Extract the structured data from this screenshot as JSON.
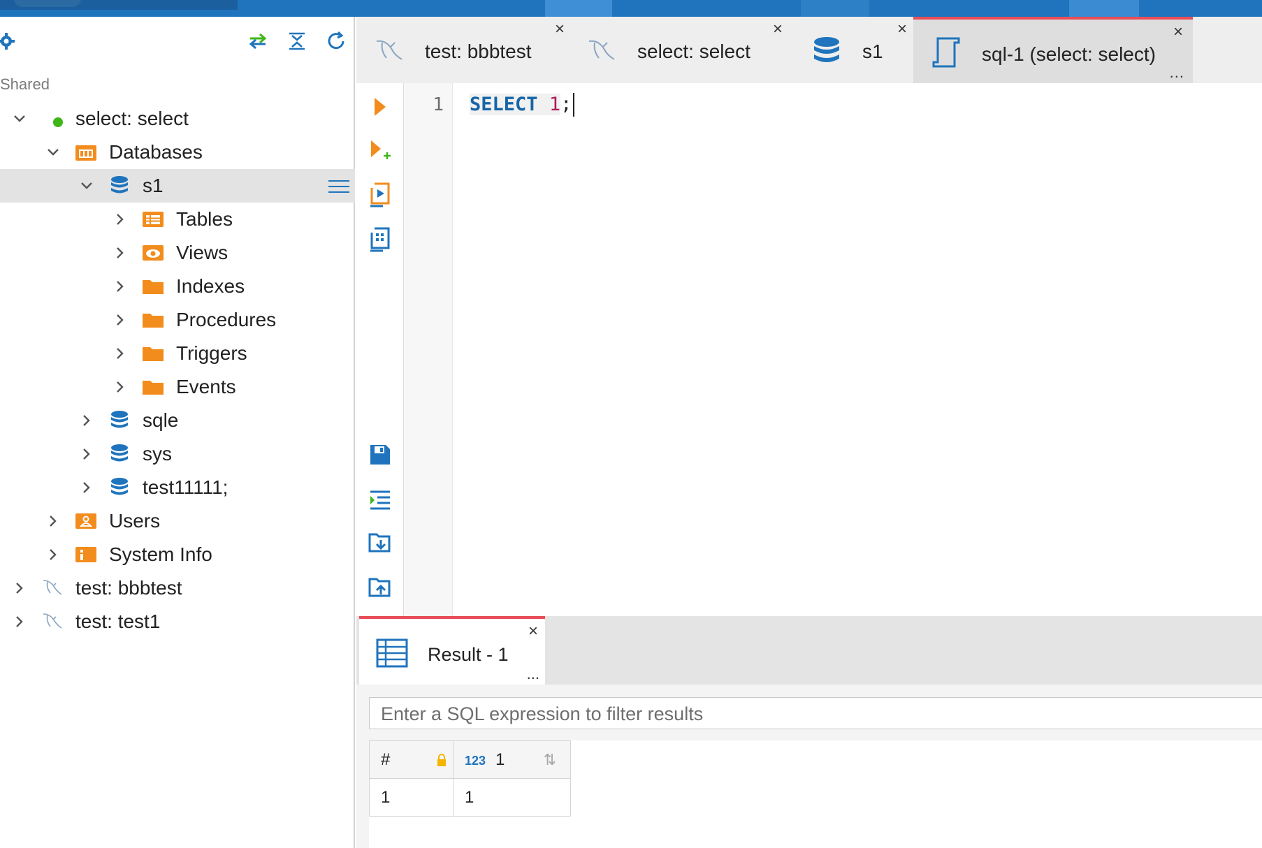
{
  "navigator": {
    "section_label": "Shared",
    "tree": [
      {
        "label": "select: select",
        "icon": "connected-dot-icon"
      },
      {
        "label": "Databases",
        "icon": "databases-folder-icon"
      },
      {
        "label": "s1",
        "icon": "database-icon"
      },
      {
        "label": "Tables",
        "icon": "tables-folder-icon"
      },
      {
        "label": "Views",
        "icon": "views-folder-icon"
      },
      {
        "label": "Indexes",
        "icon": "folder-icon"
      },
      {
        "label": "Procedures",
        "icon": "folder-icon"
      },
      {
        "label": "Triggers",
        "icon": "folder-icon"
      },
      {
        "label": "Events",
        "icon": "folder-icon"
      },
      {
        "label": "sqle",
        "icon": "database-icon"
      },
      {
        "label": "sys",
        "icon": "database-icon"
      },
      {
        "label": "test11111;",
        "icon": "database-icon"
      },
      {
        "label": "Users",
        "icon": "users-folder-icon"
      },
      {
        "label": "System Info",
        "icon": "system-info-folder-icon"
      },
      {
        "label": "test: bbbtest",
        "icon": "mysql-dolphin-icon"
      },
      {
        "label": "test: test1",
        "icon": "mysql-dolphin-icon"
      }
    ]
  },
  "tabs": [
    {
      "label": "test: bbbtest",
      "icon": "mysql-dolphin-icon",
      "close": "×"
    },
    {
      "label": "select: select",
      "icon": "mysql-dolphin-icon",
      "close": "×"
    },
    {
      "label": "s1",
      "icon": "database-icon",
      "close": "×"
    },
    {
      "label": "sql-1 (select: select)",
      "icon": "sql-script-icon",
      "close": "×",
      "more": "...",
      "active": true
    }
  ],
  "editor": {
    "line_number": "1",
    "code_keyword": "SELECT",
    "code_number": "1",
    "code_punct": ";"
  },
  "results": {
    "tab_label": "Result - 1",
    "tab_close": "×",
    "tab_more": "...",
    "filter_placeholder": "Enter a SQL expression to filter results",
    "columns": [
      {
        "label": "#"
      },
      {
        "type": "123",
        "label": "1"
      }
    ],
    "rows": [
      [
        "1",
        "1"
      ]
    ]
  },
  "colors": {
    "accent": "#1f74bd",
    "active_tab_border": "#e84e58",
    "folder_orange": "#f28c1c",
    "connected_green": "#3fb618"
  }
}
